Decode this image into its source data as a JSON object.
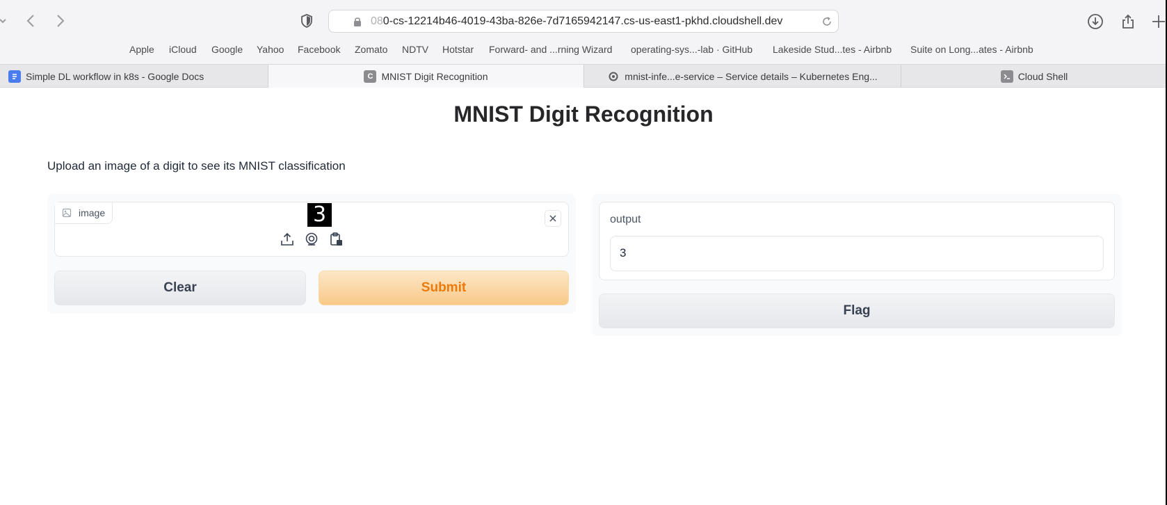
{
  "browser": {
    "url_dim": "08",
    "url_main": "0-cs-12214b46-4019-43ba-826e-7d7165942147.cs-us-east1-pkhd.cloudshell.dev",
    "bookmarks": [
      "Apple",
      "iCloud",
      "Google",
      "Yahoo",
      "Facebook",
      "Zomato",
      "NDTV",
      "Hotstar",
      "Forward- and ...rning Wizard",
      "operating-sys...-lab · GitHub",
      "Lakeside Stud...tes - Airbnb",
      "Suite on Long...ates - Airbnb"
    ],
    "tabs": [
      {
        "label": "Simple DL workflow in k8s - Google Docs",
        "favicon": "docs-icon"
      },
      {
        "label": "MNIST Digit Recognition",
        "favicon": "gradio-icon",
        "favicon_text": "C",
        "active": true
      },
      {
        "label": "mnist-infe...e-service – Service details – Kubernetes Eng...",
        "favicon": "gear-icon"
      },
      {
        "label": "Cloud Shell",
        "favicon": "terminal-icon"
      }
    ]
  },
  "app": {
    "title": "MNIST Digit Recognition",
    "description": "Upload an image of a digit to see its MNIST classification",
    "input": {
      "label": "image",
      "thumbnail_digit": "3"
    },
    "buttons": {
      "clear": "Clear",
      "submit": "Submit",
      "flag": "Flag"
    },
    "output": {
      "label": "output",
      "value": "3"
    }
  },
  "colors": {
    "submit_text": "#ea7a0b",
    "submit_bg": "#f8c987",
    "panel_bg": "#f9fafb"
  }
}
